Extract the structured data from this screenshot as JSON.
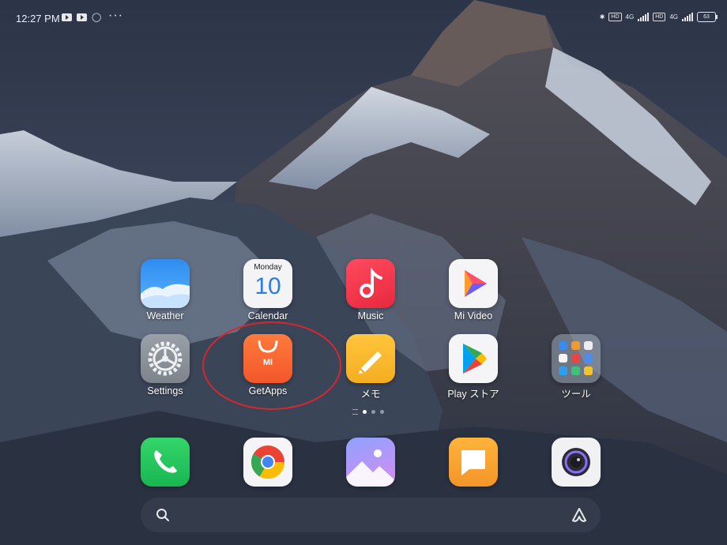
{
  "status_bar": {
    "time": "12:27 PM",
    "more": "···",
    "network_1": "4G",
    "network_2": "4G",
    "battery": "63"
  },
  "home": {
    "apps": [
      {
        "label": "Weather"
      },
      {
        "label": "Calendar",
        "day": "Monday",
        "date": "10"
      },
      {
        "label": "Music"
      },
      {
        "label": "Mi Video"
      },
      {
        "label": "Settings"
      },
      {
        "label": "GetApps",
        "badge": "MI"
      },
      {
        "label": "メモ"
      },
      {
        "label": "Play ストア"
      },
      {
        "label": "ツール"
      }
    ],
    "page_indicator": {
      "pages": 3,
      "current": 1
    }
  },
  "dock": [
    "phone",
    "chrome",
    "gallery",
    "messaging",
    "camera"
  ],
  "colors": {
    "highlight_ring": "#d6282c",
    "getapps_orange": "#f2572a"
  }
}
